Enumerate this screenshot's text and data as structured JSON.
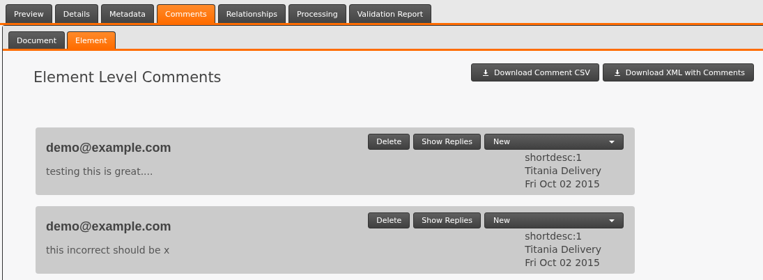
{
  "tabs": [
    {
      "label": "Preview",
      "selected": false
    },
    {
      "label": "Details",
      "selected": false
    },
    {
      "label": "Metadata",
      "selected": false
    },
    {
      "label": "Comments",
      "selected": true
    },
    {
      "label": "Relationships",
      "selected": false
    },
    {
      "label": "Processing",
      "selected": false
    },
    {
      "label": "Validation Report",
      "selected": false
    }
  ],
  "subtabs": [
    {
      "label": "Document",
      "selected": false
    },
    {
      "label": "Element",
      "selected": true
    }
  ],
  "heading": "Element Level Comments",
  "actions": [
    "Download Comment CSV",
    "Download XML with Comments"
  ],
  "comments": [
    {
      "author": "demo@example.com",
      "text": "testing this is great....",
      "buttons": [
        "Delete",
        "Show Replies"
      ],
      "status": "New",
      "meta": [
        "shortdesc:1",
        "Titania Delivery",
        "Fri Oct 02 2015"
      ]
    },
    {
      "author": "demo@example.com",
      "text": "this incorrect should be x",
      "buttons": [
        "Delete",
        "Show Replies"
      ],
      "status": "New",
      "meta": [
        "shortdesc:1",
        "Titania Delivery",
        "Fri Oct 02 2015"
      ]
    }
  ]
}
